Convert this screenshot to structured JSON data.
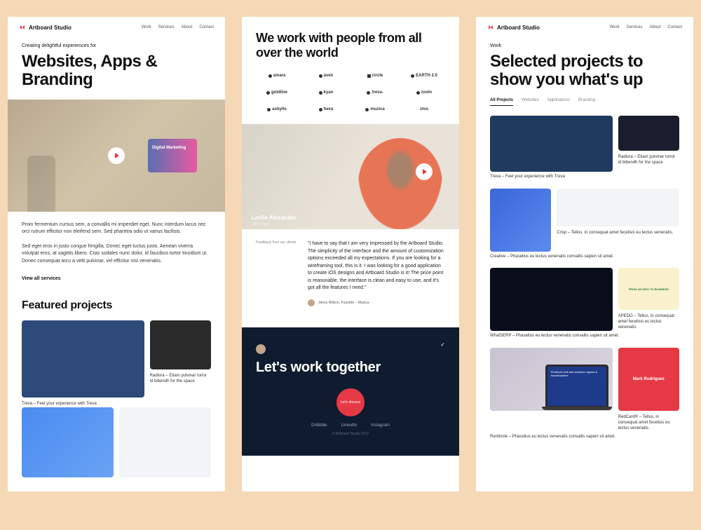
{
  "brand": "Artboard Studio",
  "nav": {
    "work": "Work",
    "services": "Services",
    "about": "About",
    "contact": "Contact"
  },
  "col1": {
    "kicker": "Creating delightful experiences for",
    "title": "Websites, Apps & Branding",
    "heroBadge": "Digital Marketing",
    "body1": "Proin fermentum cursus sem, a convallis mi imperdiet eget. Nunc interdum lacus nec orci rutrum efficitur non eleifend sem. Sed pharetra odio ut varius facilisis.",
    "body2": "Sed eget eros in justo congue fringilla. Donec eget luctus justo. Aenean viverra volutpat eros, at sagittis libero. Cras sodales nunc dolor, id faucibus tortor tincidunt ut. Donec consequat arcu a velit pulvinar, vel efficitur nisl venenatis.",
    "viewAll": "View all services",
    "featuredTitle": "Featured projects",
    "proj1cap": "Treva – Feel your experience with Treva",
    "proj2cap": "Radiora – Etiam pulvinar tortor id bibendh for the space"
  },
  "col2": {
    "title": "We work with people from all over the world",
    "clients": [
      "amara",
      "aven",
      "circle",
      "EARTH 2.0",
      "goldline",
      "kyan",
      "treva.",
      "zootv",
      "asbyllo",
      "hexa",
      "muzica",
      "ztos"
    ],
    "tName": "Leslie Alexander",
    "tRole": "CEO Treva",
    "feedbackLabel": "Feedback from our clients",
    "quote": "\"I have to say that I am very impressed by the Artboard Studio. The simplicity of the interface and the amount of customization options exceeded all my expectations. If you are looking for a wireframing tool, this is it. I was looking for a good application to create iOS designs and Artboard Studio is it! The price point is reasonable, the interface is clean and easy to use, and it's got all the features I need.\"",
    "quoteAuthor": "Jenny Wilson, Founder – Muzica",
    "ctaTitle": "Let's work together",
    "ctaBtn": "Let's discuss",
    "footer": {
      "dribbble": "Dribbble",
      "linkedin": "LinkedIn",
      "instagram": "Instagram"
    },
    "copy": "© Artboard Studio 2022"
  },
  "col3": {
    "kicker": "Work",
    "title": "Selected projects to show you what's up",
    "tabs": {
      "all": "All Projects",
      "web": "Websites",
      "app": "Applications",
      "brand": "Branding"
    },
    "caps": {
      "treva": "Treva – Feel your experience with Treva",
      "radiora": "Radiora – Etiam pulvinar tortor id bibendh for the space",
      "crisp": "Crisp – Tellus, in consequat amet fecelisis eu lectus venenatis.",
      "creative": "Creative – Phasellus eu lectus venenatis convallis sapien sit amet.",
      "apedo": "APEDO – Tellus, in consequat amet fecelisis eu lectus venenatis.",
      "whatserp": "WhatSERP – Phasellus eu lectus venenatis convallis sapien sit amet.",
      "redcard": "RedCard® – Tellus, in consequat amet fecelisis eu lectus venenatis.",
      "rentincle": "Rentincle – Phasellus eu lectus venenatis convallis sapien sit amet.",
      "yellowText": "FROM AN IDEA TO BUSINESS",
      "redText": "Mark Rodriguez",
      "lapText": "Rentincle bulk ads solutions agents & housebuilders"
    }
  }
}
